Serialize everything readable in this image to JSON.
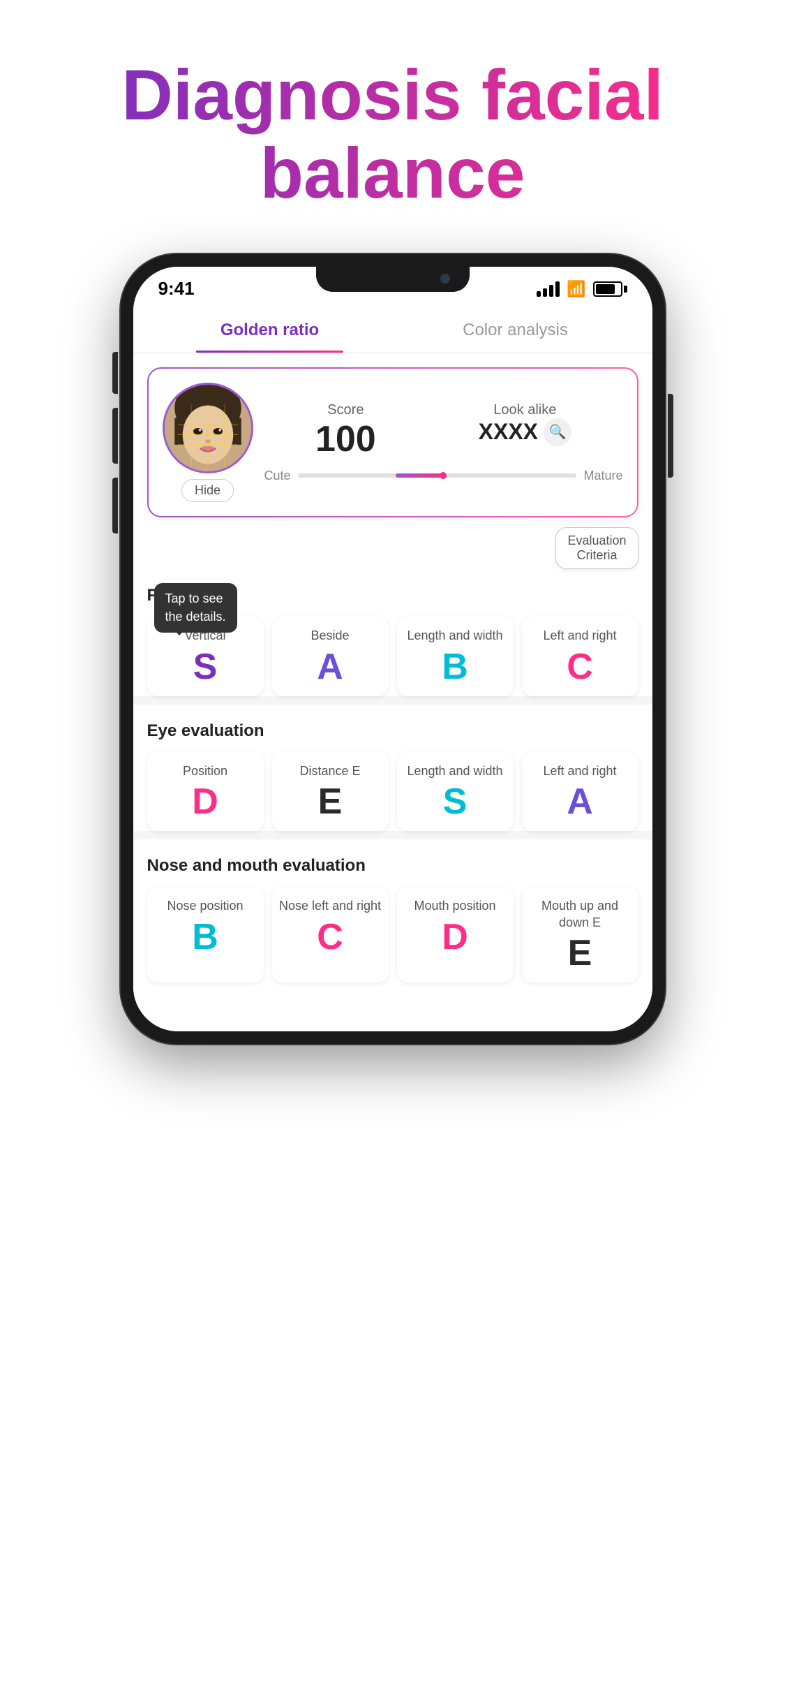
{
  "hero": {
    "title_line1": "Diagnosis facial",
    "title_line2": "balance"
  },
  "status_bar": {
    "time": "9:41",
    "signal": "4 bars",
    "wifi": "wifi",
    "battery": "80%"
  },
  "tabs": [
    {
      "id": "golden_ratio",
      "label": "Golden ratio",
      "active": true
    },
    {
      "id": "color_analysis",
      "label": "Color analysis",
      "active": false
    }
  ],
  "score_card": {
    "score_label": "Score",
    "score_value": "100",
    "look_alike_label": "Look alike",
    "look_alike_value": "XXXX",
    "hide_btn": "Hide",
    "slider_left": "Cute",
    "slider_right": "Mature"
  },
  "evaluation_criteria_btn": "Evaluation\nCriteria",
  "face_evaluation": {
    "title": "Face eva...",
    "tooltip": "Tap to see\nthe details.",
    "cards": [
      {
        "label": "Vertical",
        "grade": "S",
        "color": "grade-purple"
      },
      {
        "label": "Beside",
        "grade": "A",
        "color": "grade-violet"
      },
      {
        "label": "Length and width",
        "grade": "B",
        "color": "grade-teal"
      },
      {
        "label": "Left and right",
        "grade": "C",
        "color": "grade-pink"
      }
    ]
  },
  "eye_evaluation": {
    "title": "Eye evaluation",
    "cards": [
      {
        "label": "Position",
        "grade": "D",
        "color": "grade-pink"
      },
      {
        "label": "Distance E",
        "grade": "E",
        "color": "grade-dark"
      },
      {
        "label": "Length and width",
        "grade": "S",
        "color": "grade-teal"
      },
      {
        "label": "Left and right",
        "grade": "A",
        "color": "grade-violet"
      }
    ]
  },
  "nose_mouth_evaluation": {
    "title": "Nose and mouth evaluation",
    "cards": [
      {
        "label": "Nose position",
        "grade": "B",
        "color": "grade-teal"
      },
      {
        "label": "Nose left and right",
        "grade": "C",
        "color": "grade-pink"
      },
      {
        "label": "Mouth position",
        "grade": "D",
        "color": "grade-pink"
      },
      {
        "label": "Mouth up and down E",
        "grade": "E",
        "color": "grade-dark"
      }
    ]
  }
}
